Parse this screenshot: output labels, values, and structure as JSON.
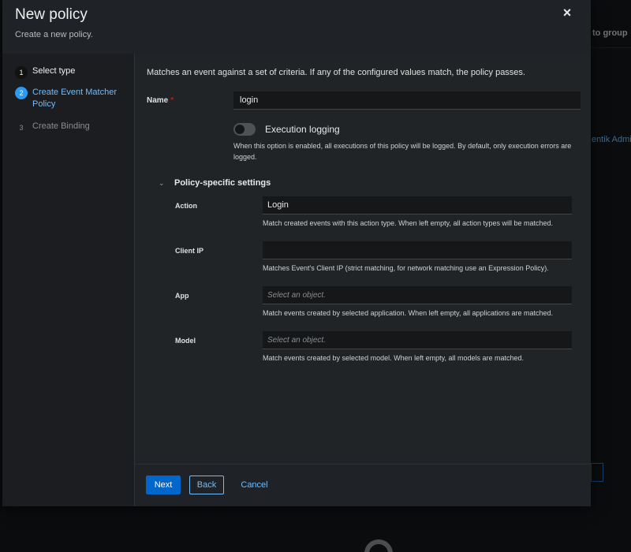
{
  "background": {
    "col_header": "to group",
    "row_link": "entik Admins"
  },
  "modal": {
    "title": "New policy",
    "subtitle": "Create a new policy.",
    "close_icon": "×"
  },
  "wizard": {
    "steps": [
      {
        "num": "1",
        "label": "Select type",
        "state": "done"
      },
      {
        "num": "2",
        "label": "Create Event Matcher Policy",
        "state": "current"
      },
      {
        "num": "3",
        "label": "Create Binding",
        "state": "pending"
      }
    ]
  },
  "form": {
    "intro": "Matches an event against a set of criteria. If any of the configured values match, the policy passes.",
    "name_label": "Name",
    "required_mark": "*",
    "name_value": "login",
    "execution_logging": {
      "label": "Execution logging",
      "enabled": false,
      "help": "When this option is enabled, all executions of this policy will be logged. By default, only execution errors are logged."
    },
    "section_title": "Policy-specific settings",
    "fields": {
      "action": {
        "label": "Action",
        "value": "Login",
        "help": "Match created events with this action type. When left empty, all action types will be matched."
      },
      "client_ip": {
        "label": "Client IP",
        "value": "",
        "help": "Matches Event's Client IP (strict matching, for network matching use an Expression Policy)."
      },
      "app": {
        "label": "App",
        "placeholder": "Select an object.",
        "help": "Match events created by selected application. When left empty, all applications are matched."
      },
      "model": {
        "label": "Model",
        "placeholder": "Select an object.",
        "help": "Match events created by selected model. When left empty, all models are matched."
      }
    }
  },
  "footer": {
    "next_label": "Next",
    "back_label": "Back",
    "cancel_label": "Cancel"
  },
  "colors": {
    "accent": "#73bcf7",
    "primary": "#0066cc",
    "required": "#c9190b"
  }
}
